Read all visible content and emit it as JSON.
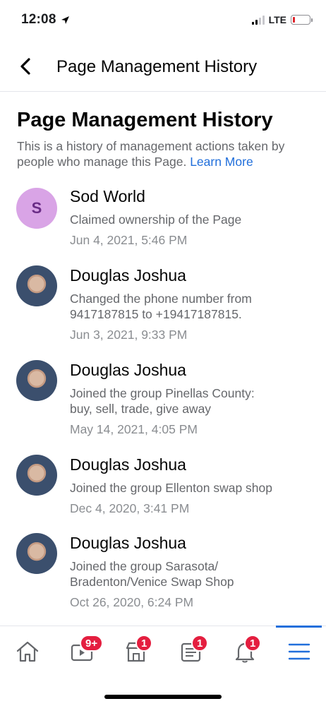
{
  "status": {
    "time": "12:08",
    "network": "LTE"
  },
  "header": {
    "title": "Page Management History"
  },
  "main": {
    "title": "Page Management History",
    "description": "This is a history of management actions taken by people who manage this Page.",
    "learn_more": "Learn More",
    "entries": [
      {
        "avatar_letter": "S",
        "name": "Sod World",
        "action": "Claimed ownership of the Page",
        "time": "Jun 4, 2021, 5:46 PM"
      },
      {
        "name": "Douglas Joshua",
        "action": "Changed the phone number from 9417187815 to +19417187815.",
        "time": "Jun 3, 2021, 9:33 PM"
      },
      {
        "name": "Douglas Joshua",
        "action": "Joined the group Pinellas County: buy, sell, trade, give away",
        "time": "May 14, 2021, 4:05 PM"
      },
      {
        "name": "Douglas Joshua",
        "action": "Joined the group Ellenton swap shop",
        "time": "Dec 4, 2020, 3:41 PM"
      },
      {
        "name": "Douglas Joshua",
        "action": "Joined the group Sarasota/ Bradenton/Venice Swap Shop",
        "time": "Oct 26, 2020, 6:24 PM"
      }
    ]
  },
  "tabs": [
    {
      "icon": "home-icon"
    },
    {
      "icon": "watch-icon",
      "badge": "9+"
    },
    {
      "icon": "marketplace-icon",
      "badge": "1"
    },
    {
      "icon": "news-icon",
      "badge": "1"
    },
    {
      "icon": "bell-icon",
      "badge": "1"
    },
    {
      "icon": "menu-icon",
      "active": true
    }
  ],
  "colors": {
    "accent": "#216fdb",
    "badge": "#e41e3f",
    "secondary_text": "#65676b"
  }
}
